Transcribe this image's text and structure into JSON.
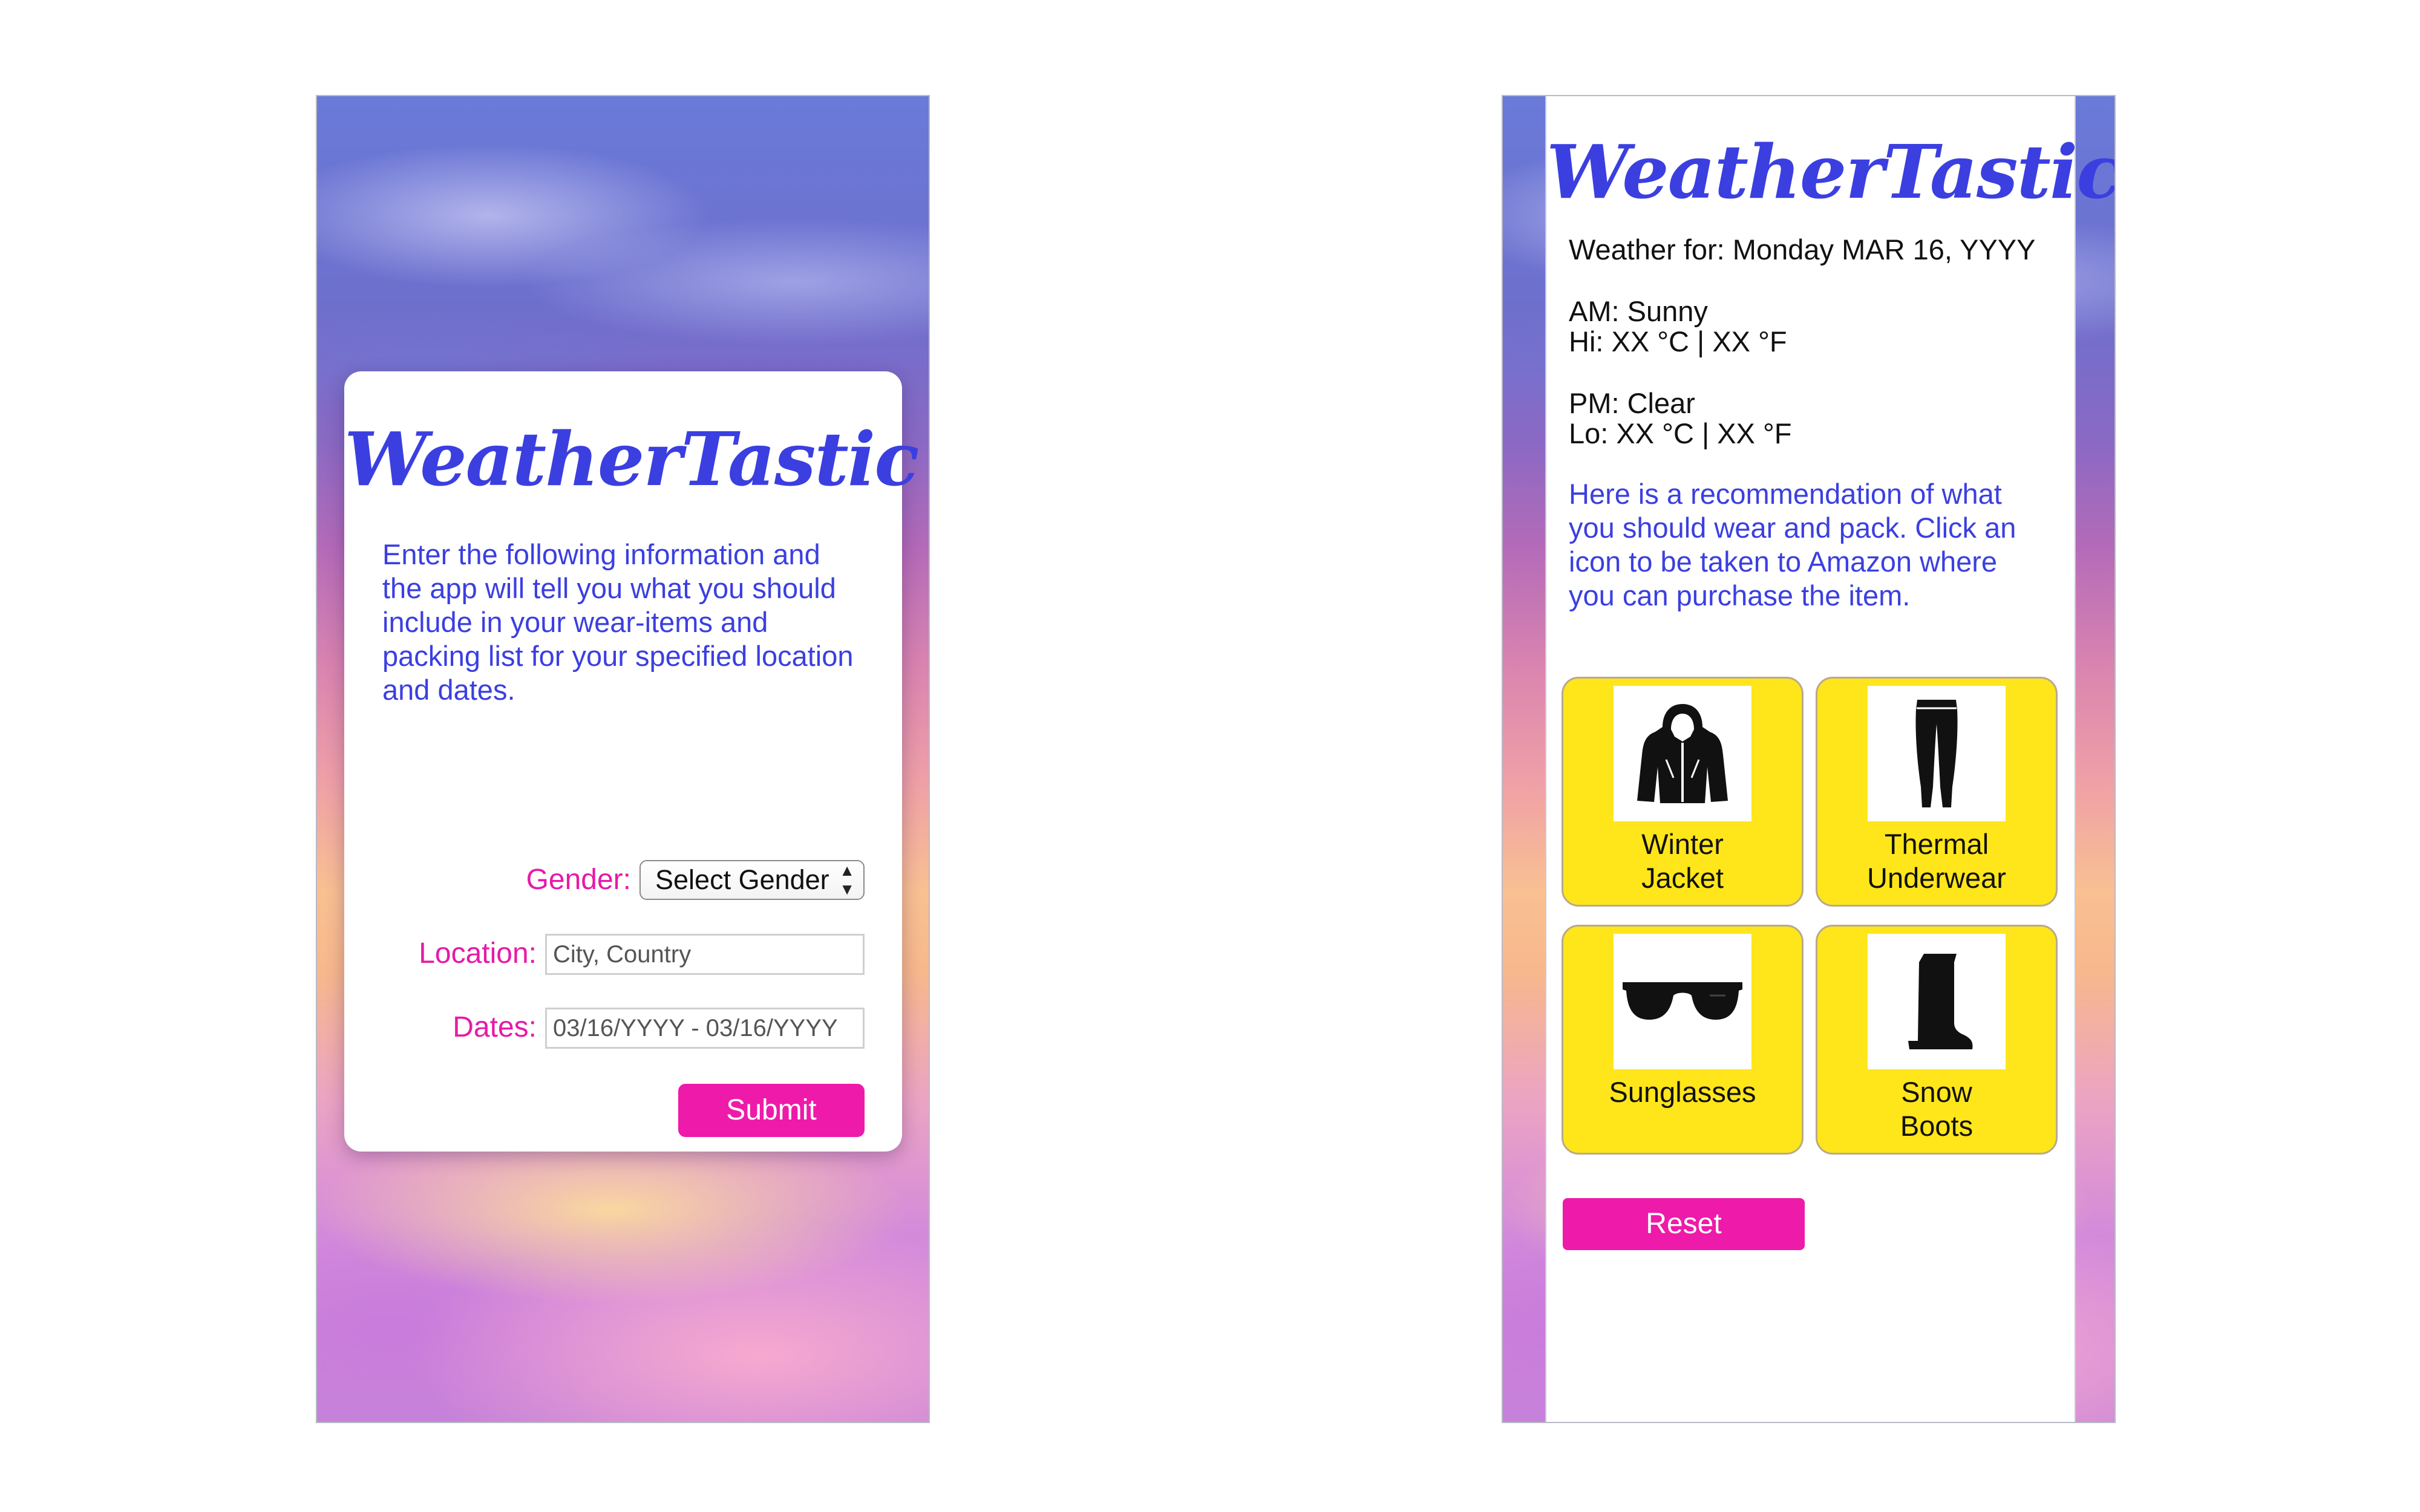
{
  "app": {
    "logo": "WeatherTastic"
  },
  "form_screen": {
    "intro": "Enter the following information and the app will tell you what you should include in your wear-items and packing list for your specified location and dates.",
    "gender": {
      "label": "Gender:",
      "selected": "Select Gender"
    },
    "location": {
      "label": "Location:",
      "placeholder": "City, Country"
    },
    "dates": {
      "label": "Dates:",
      "value": "03/16/YYYY - 03/16/YYYY"
    },
    "submit_label": "Submit"
  },
  "result_screen": {
    "weather_for": "Weather for: Monday MAR 16, YYYY",
    "am": "AM: Sunny",
    "hi": "Hi: XX °C | XX °F",
    "pm": "PM: Clear",
    "lo": "Lo: XX °C | XX °F",
    "recommendation": "Here is a recommendation of what you should wear and pack. Click an icon to be taken to Amazon where you can purchase the item.",
    "items": [
      {
        "line1": "Winter",
        "line2": "Jacket",
        "icon": "winter-jacket-icon"
      },
      {
        "line1": "Thermal",
        "line2": "Underwear",
        "icon": "thermal-underwear-icon"
      },
      {
        "line1": "Sunglasses",
        "line2": "",
        "icon": "sunglasses-icon"
      },
      {
        "line1": "Snow",
        "line2": "Boots",
        "icon": "snow-boots-icon"
      }
    ],
    "reset_label": "Reset"
  },
  "colors": {
    "brand_blue": "#3b3fe0",
    "accent_pink": "#ee1aa9",
    "tile_yellow": "#ffe61a"
  }
}
